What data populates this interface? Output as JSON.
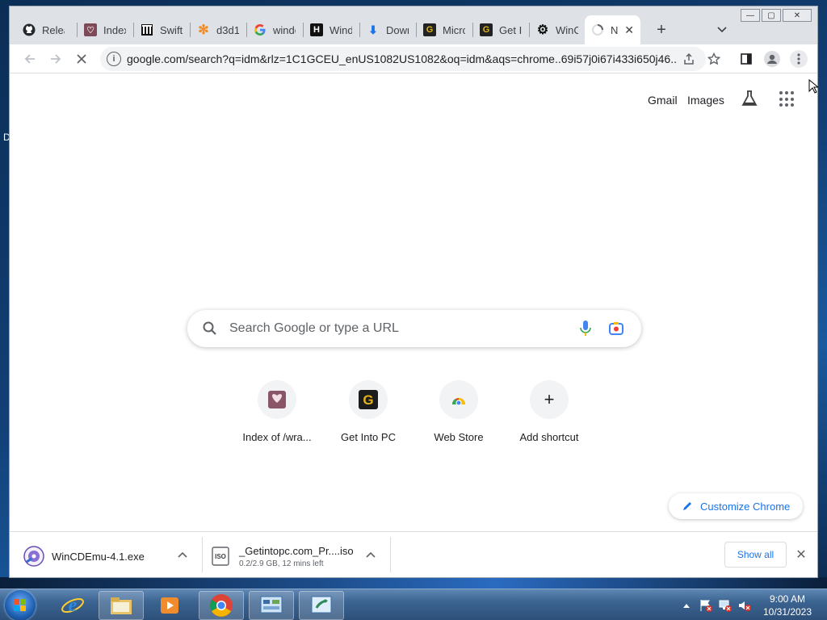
{
  "browser": {
    "tabs": [
      {
        "label": "Releases",
        "icon": "github-icon"
      },
      {
        "label": "Index of",
        "icon": "index-favicon-icon"
      },
      {
        "label": "Swift",
        "icon": "swift-bank-icon"
      },
      {
        "label": "d3d1",
        "icon": "orange-asterisk-icon"
      },
      {
        "label": "windo",
        "icon": "google-icon"
      },
      {
        "label": "Windo",
        "icon": "h-logo-icon"
      },
      {
        "label": "Down",
        "icon": "download-arrow-icon"
      },
      {
        "label": "Micro",
        "icon": "getintopc-icon"
      },
      {
        "label": "Get In",
        "icon": "getintopc-icon"
      },
      {
        "label": "WinC",
        "icon": "gear-icon"
      },
      {
        "label": "Ne",
        "icon": "loading-spinner-icon"
      }
    ],
    "new_tab_glyph": "+",
    "tab_close_glyph": "✕",
    "url": "google.com/search?q=idm&rlz=1C1GCEU_enUS1082US1082&oq=idm&aqs=chrome..69i57j0i67i433i650j46...",
    "window_buttons": {
      "minimize": "—",
      "maximize": "▢",
      "close": "✕"
    }
  },
  "page": {
    "gmail": "Gmail",
    "images": "Images",
    "search_placeholder": "Search Google or type a URL",
    "shortcuts": [
      {
        "label": "Index of /wra...",
        "icon": "index-favicon-icon"
      },
      {
        "label": "Get Into PC",
        "icon": "getintopc-icon"
      },
      {
        "label": "Web Store",
        "icon": "chrome-webstore-icon"
      },
      {
        "label": "Add shortcut",
        "icon": "plus-icon"
      }
    ],
    "customize": "Customize Chrome"
  },
  "downloads": {
    "items": [
      {
        "name": "WinCDEmu-4.1.exe",
        "status": ""
      },
      {
        "name": "_Getintopc.com_Pr....iso",
        "status": "0.2/2.9 GB, 12 mins left"
      }
    ],
    "show_all": "Show all",
    "close_glyph": "✕"
  },
  "taskbar": {
    "time": "9:00 AM",
    "date": "10/31/2023",
    "apps": [
      "internet-explorer-icon",
      "file-explorer-icon",
      "media-player-icon",
      "chrome-icon",
      "control-panel-icon",
      "windows-update-icon"
    ]
  },
  "desktop": {
    "edge_text": "D"
  }
}
